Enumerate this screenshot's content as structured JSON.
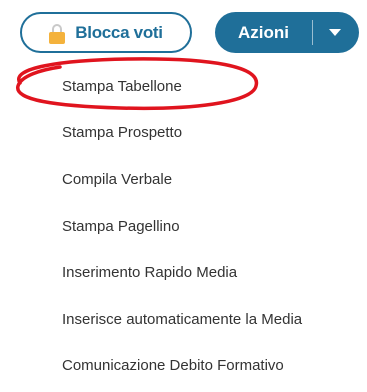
{
  "toolbar": {
    "lock_button_label": "Blocca voti",
    "lock_icon": "padlock-icon",
    "actions_button_label": "Azioni",
    "actions_caret_icon": "caret-down-icon"
  },
  "menu": {
    "items": [
      {
        "label": "Stampa Tabellone"
      },
      {
        "label": "Stampa Prospetto"
      },
      {
        "label": "Compila Verbale"
      },
      {
        "label": "Stampa Pagellino"
      },
      {
        "label": "Inserimento Rapido Media"
      },
      {
        "label": "Inserisce automaticamente la Media"
      },
      {
        "label": "Comunicazione Debito Formativo"
      }
    ]
  },
  "colors": {
    "primary": "#1f6f99",
    "lock_body": "#f4b23c",
    "highlight_circle": "#e0141e",
    "menu_text": "#333333"
  }
}
